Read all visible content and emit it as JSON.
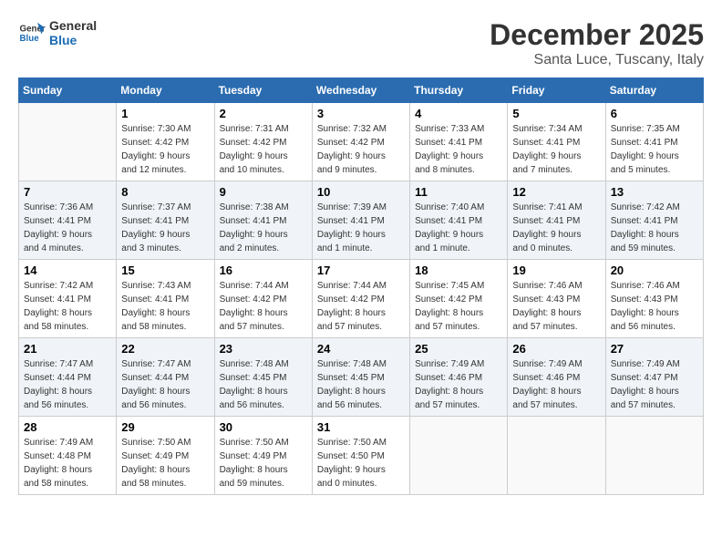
{
  "logo": {
    "line1": "General",
    "line2": "Blue"
  },
  "title": "December 2025",
  "subtitle": "Santa Luce, Tuscany, Italy",
  "days_of_week": [
    "Sunday",
    "Monday",
    "Tuesday",
    "Wednesday",
    "Thursday",
    "Friday",
    "Saturday"
  ],
  "weeks": [
    [
      {
        "day": "",
        "detail": ""
      },
      {
        "day": "1",
        "detail": "Sunrise: 7:30 AM\nSunset: 4:42 PM\nDaylight: 9 hours\nand 12 minutes."
      },
      {
        "day": "2",
        "detail": "Sunrise: 7:31 AM\nSunset: 4:42 PM\nDaylight: 9 hours\nand 10 minutes."
      },
      {
        "day": "3",
        "detail": "Sunrise: 7:32 AM\nSunset: 4:42 PM\nDaylight: 9 hours\nand 9 minutes."
      },
      {
        "day": "4",
        "detail": "Sunrise: 7:33 AM\nSunset: 4:41 PM\nDaylight: 9 hours\nand 8 minutes."
      },
      {
        "day": "5",
        "detail": "Sunrise: 7:34 AM\nSunset: 4:41 PM\nDaylight: 9 hours\nand 7 minutes."
      },
      {
        "day": "6",
        "detail": "Sunrise: 7:35 AM\nSunset: 4:41 PM\nDaylight: 9 hours\nand 5 minutes."
      }
    ],
    [
      {
        "day": "7",
        "detail": "Sunrise: 7:36 AM\nSunset: 4:41 PM\nDaylight: 9 hours\nand 4 minutes."
      },
      {
        "day": "8",
        "detail": "Sunrise: 7:37 AM\nSunset: 4:41 PM\nDaylight: 9 hours\nand 3 minutes."
      },
      {
        "day": "9",
        "detail": "Sunrise: 7:38 AM\nSunset: 4:41 PM\nDaylight: 9 hours\nand 2 minutes."
      },
      {
        "day": "10",
        "detail": "Sunrise: 7:39 AM\nSunset: 4:41 PM\nDaylight: 9 hours\nand 1 minute."
      },
      {
        "day": "11",
        "detail": "Sunrise: 7:40 AM\nSunset: 4:41 PM\nDaylight: 9 hours\nand 1 minute."
      },
      {
        "day": "12",
        "detail": "Sunrise: 7:41 AM\nSunset: 4:41 PM\nDaylight: 9 hours\nand 0 minutes."
      },
      {
        "day": "13",
        "detail": "Sunrise: 7:42 AM\nSunset: 4:41 PM\nDaylight: 8 hours\nand 59 minutes."
      }
    ],
    [
      {
        "day": "14",
        "detail": "Sunrise: 7:42 AM\nSunset: 4:41 PM\nDaylight: 8 hours\nand 58 minutes."
      },
      {
        "day": "15",
        "detail": "Sunrise: 7:43 AM\nSunset: 4:41 PM\nDaylight: 8 hours\nand 58 minutes."
      },
      {
        "day": "16",
        "detail": "Sunrise: 7:44 AM\nSunset: 4:42 PM\nDaylight: 8 hours\nand 57 minutes."
      },
      {
        "day": "17",
        "detail": "Sunrise: 7:44 AM\nSunset: 4:42 PM\nDaylight: 8 hours\nand 57 minutes."
      },
      {
        "day": "18",
        "detail": "Sunrise: 7:45 AM\nSunset: 4:42 PM\nDaylight: 8 hours\nand 57 minutes."
      },
      {
        "day": "19",
        "detail": "Sunrise: 7:46 AM\nSunset: 4:43 PM\nDaylight: 8 hours\nand 57 minutes."
      },
      {
        "day": "20",
        "detail": "Sunrise: 7:46 AM\nSunset: 4:43 PM\nDaylight: 8 hours\nand 56 minutes."
      }
    ],
    [
      {
        "day": "21",
        "detail": "Sunrise: 7:47 AM\nSunset: 4:44 PM\nDaylight: 8 hours\nand 56 minutes."
      },
      {
        "day": "22",
        "detail": "Sunrise: 7:47 AM\nSunset: 4:44 PM\nDaylight: 8 hours\nand 56 minutes."
      },
      {
        "day": "23",
        "detail": "Sunrise: 7:48 AM\nSunset: 4:45 PM\nDaylight: 8 hours\nand 56 minutes."
      },
      {
        "day": "24",
        "detail": "Sunrise: 7:48 AM\nSunset: 4:45 PM\nDaylight: 8 hours\nand 56 minutes."
      },
      {
        "day": "25",
        "detail": "Sunrise: 7:49 AM\nSunset: 4:46 PM\nDaylight: 8 hours\nand 57 minutes."
      },
      {
        "day": "26",
        "detail": "Sunrise: 7:49 AM\nSunset: 4:46 PM\nDaylight: 8 hours\nand 57 minutes."
      },
      {
        "day": "27",
        "detail": "Sunrise: 7:49 AM\nSunset: 4:47 PM\nDaylight: 8 hours\nand 57 minutes."
      }
    ],
    [
      {
        "day": "28",
        "detail": "Sunrise: 7:49 AM\nSunset: 4:48 PM\nDaylight: 8 hours\nand 58 minutes."
      },
      {
        "day": "29",
        "detail": "Sunrise: 7:50 AM\nSunset: 4:49 PM\nDaylight: 8 hours\nand 58 minutes."
      },
      {
        "day": "30",
        "detail": "Sunrise: 7:50 AM\nSunset: 4:49 PM\nDaylight: 8 hours\nand 59 minutes."
      },
      {
        "day": "31",
        "detail": "Sunrise: 7:50 AM\nSunset: 4:50 PM\nDaylight: 9 hours\nand 0 minutes."
      },
      {
        "day": "",
        "detail": ""
      },
      {
        "day": "",
        "detail": ""
      },
      {
        "day": "",
        "detail": ""
      }
    ]
  ]
}
